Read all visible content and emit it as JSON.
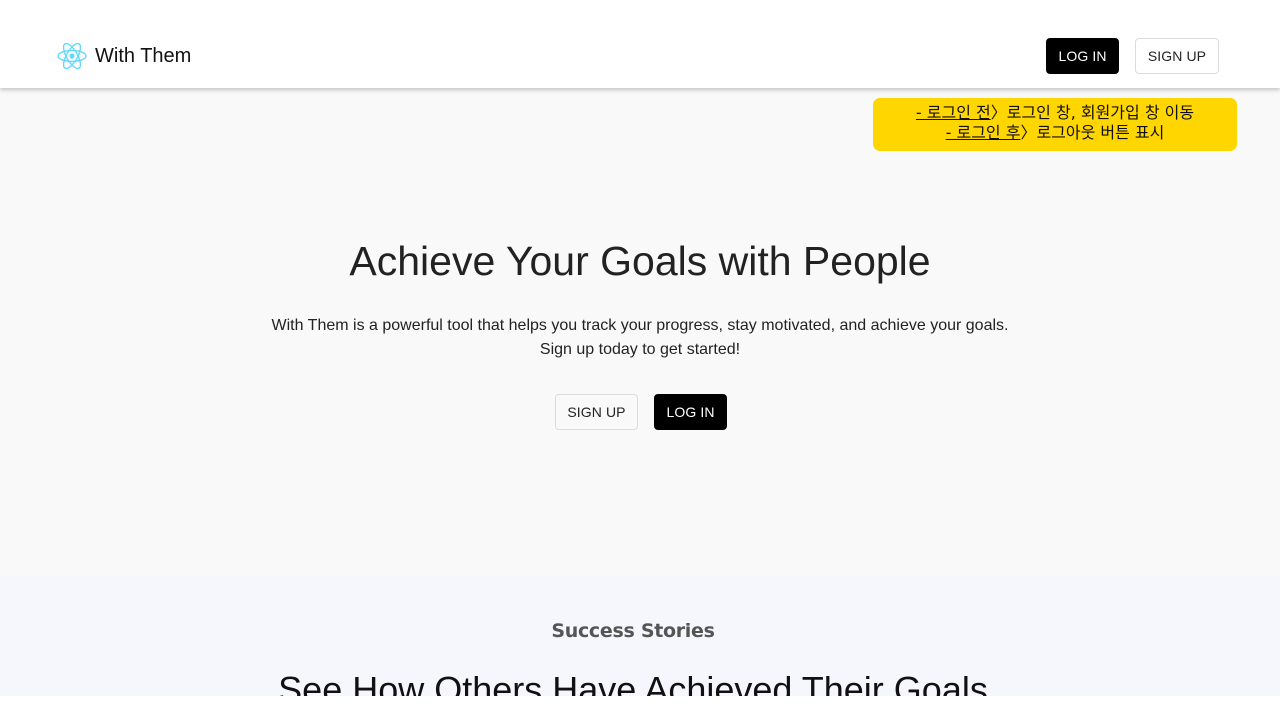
{
  "header": {
    "brand_name": "With Them",
    "login_label": "LOG IN",
    "signup_label": "SIGN UP"
  },
  "annotation": {
    "line1_key": "- 로그인 전",
    "line1_rest": "〉로그인 창, 회원가입 창 이동",
    "line2_key": "- 로그인 후",
    "line2_rest": "〉로그아웃 버튼 표시",
    "background_color": "#ffd600"
  },
  "hero": {
    "title": "Achieve Your Goals with People",
    "description_line1": "With Them is a powerful tool that helps you track your progress, stay motivated, and achieve your goals.",
    "description_line2": "Sign up today to get started!",
    "signup_label": "SIGN UP",
    "login_label": "LOG IN"
  },
  "stories": {
    "eyebrow": "Success Stories",
    "title": "See How Others Have Achieved Their Goals"
  },
  "icons": {
    "brand_logo": "atom-icon"
  },
  "colors": {
    "primary_button": "#000000",
    "logo_accent": "#61dafb",
    "hero_background": "#f9f9f9",
    "stories_background": "#f6f6fd"
  }
}
